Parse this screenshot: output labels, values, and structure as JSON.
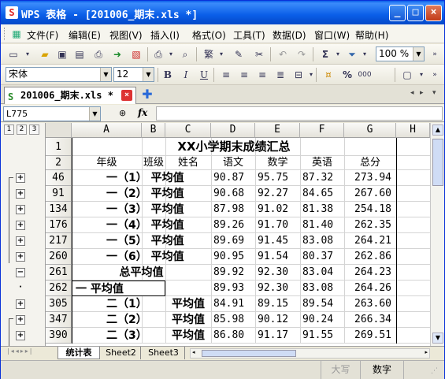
{
  "window": {
    "app_name": "WPS 表格",
    "separator": " - ",
    "doc_title": "[201006_期末.xls *]"
  },
  "menu": [
    "文件(F)",
    "编辑(E)",
    "视图(V)",
    "插入(I)",
    "格式(O)",
    "工具(T)",
    "数据(D)",
    "窗口(W)",
    "帮助(H)"
  ],
  "toolbar": {
    "zoom": "100 %",
    "sigma": "Σ",
    "font_name": "宋体",
    "font_size": "12",
    "bold": "B",
    "italic": "I",
    "underline": "U",
    "percent": "%",
    "thousands": "000"
  },
  "doc_tab": {
    "label": "201006_期末.xls *"
  },
  "formula": {
    "name_box": "L775",
    "fx": "fx",
    "value": ""
  },
  "outline_levels": [
    "1",
    "2",
    "3"
  ],
  "columns": [
    "A",
    "B",
    "C",
    "D",
    "E",
    "F",
    "G",
    "H"
  ],
  "rows": [
    {
      "rownum": "1",
      "kind": "title",
      "text": "XX小学期末成绩汇总"
    },
    {
      "rownum": "2",
      "kind": "header",
      "cells": [
        "年级",
        "班级",
        "姓名",
        "语文",
        "数学",
        "英语",
        "总分"
      ]
    },
    {
      "rownum": "46",
      "kind": "avg",
      "label": "一（1） 平均值",
      "d": "90.87",
      "e": "95.75",
      "f": "87.32",
      "g": "273.94",
      "btn": "+"
    },
    {
      "rownum": "91",
      "kind": "avg",
      "label": "一（2） 平均值",
      "d": "90.68",
      "e": "92.27",
      "f": "84.65",
      "g": "267.60",
      "btn": "+"
    },
    {
      "rownum": "134",
      "kind": "avg",
      "label": "一（3） 平均值",
      "d": "87.98",
      "e": "91.02",
      "f": "81.38",
      "g": "254.18",
      "btn": "+"
    },
    {
      "rownum": "176",
      "kind": "avg",
      "label": "一（4） 平均值",
      "d": "89.26",
      "e": "91.70",
      "f": "81.40",
      "g": "262.35",
      "btn": "+"
    },
    {
      "rownum": "217",
      "kind": "avg",
      "label": "一（5） 平均值",
      "d": "89.69",
      "e": "91.45",
      "f": "83.08",
      "g": "264.21",
      "btn": "+"
    },
    {
      "rownum": "260",
      "kind": "avg",
      "label": "一（6） 平均值",
      "d": "90.95",
      "e": "91.54",
      "f": "80.37",
      "g": "262.86",
      "btn": "+"
    },
    {
      "rownum": "261",
      "kind": "total",
      "label": "总平均值",
      "d": "89.92",
      "e": "92.30",
      "f": "83.04",
      "g": "264.23",
      "btn": "−"
    },
    {
      "rownum": "262",
      "kind": "grade",
      "label": "一 平均值",
      "d": "89.93",
      "e": "92.30",
      "f": "83.08",
      "g": "264.26",
      "btn": "·"
    },
    {
      "rownum": "305",
      "kind": "avg2",
      "label1": "二（1）",
      "label2": "平均值",
      "d": "84.91",
      "e": "89.15",
      "f": "89.54",
      "g": "263.60",
      "btn": "+"
    },
    {
      "rownum": "347",
      "kind": "avg2",
      "label1": "二（2）",
      "label2": "平均值",
      "d": "85.98",
      "e": "90.12",
      "f": "90.24",
      "g": "266.34",
      "btn": "+"
    },
    {
      "rownum": "390",
      "kind": "avg2",
      "label1": "二（3）",
      "label2": "平均值",
      "d": "86.80",
      "e": "91.17",
      "f": "91.55",
      "g": "269.51",
      "btn": "+"
    }
  ],
  "sheets": [
    "统计表",
    "Sheet2",
    "Sheet3"
  ],
  "status": {
    "caps": "大写",
    "num": "数字"
  }
}
